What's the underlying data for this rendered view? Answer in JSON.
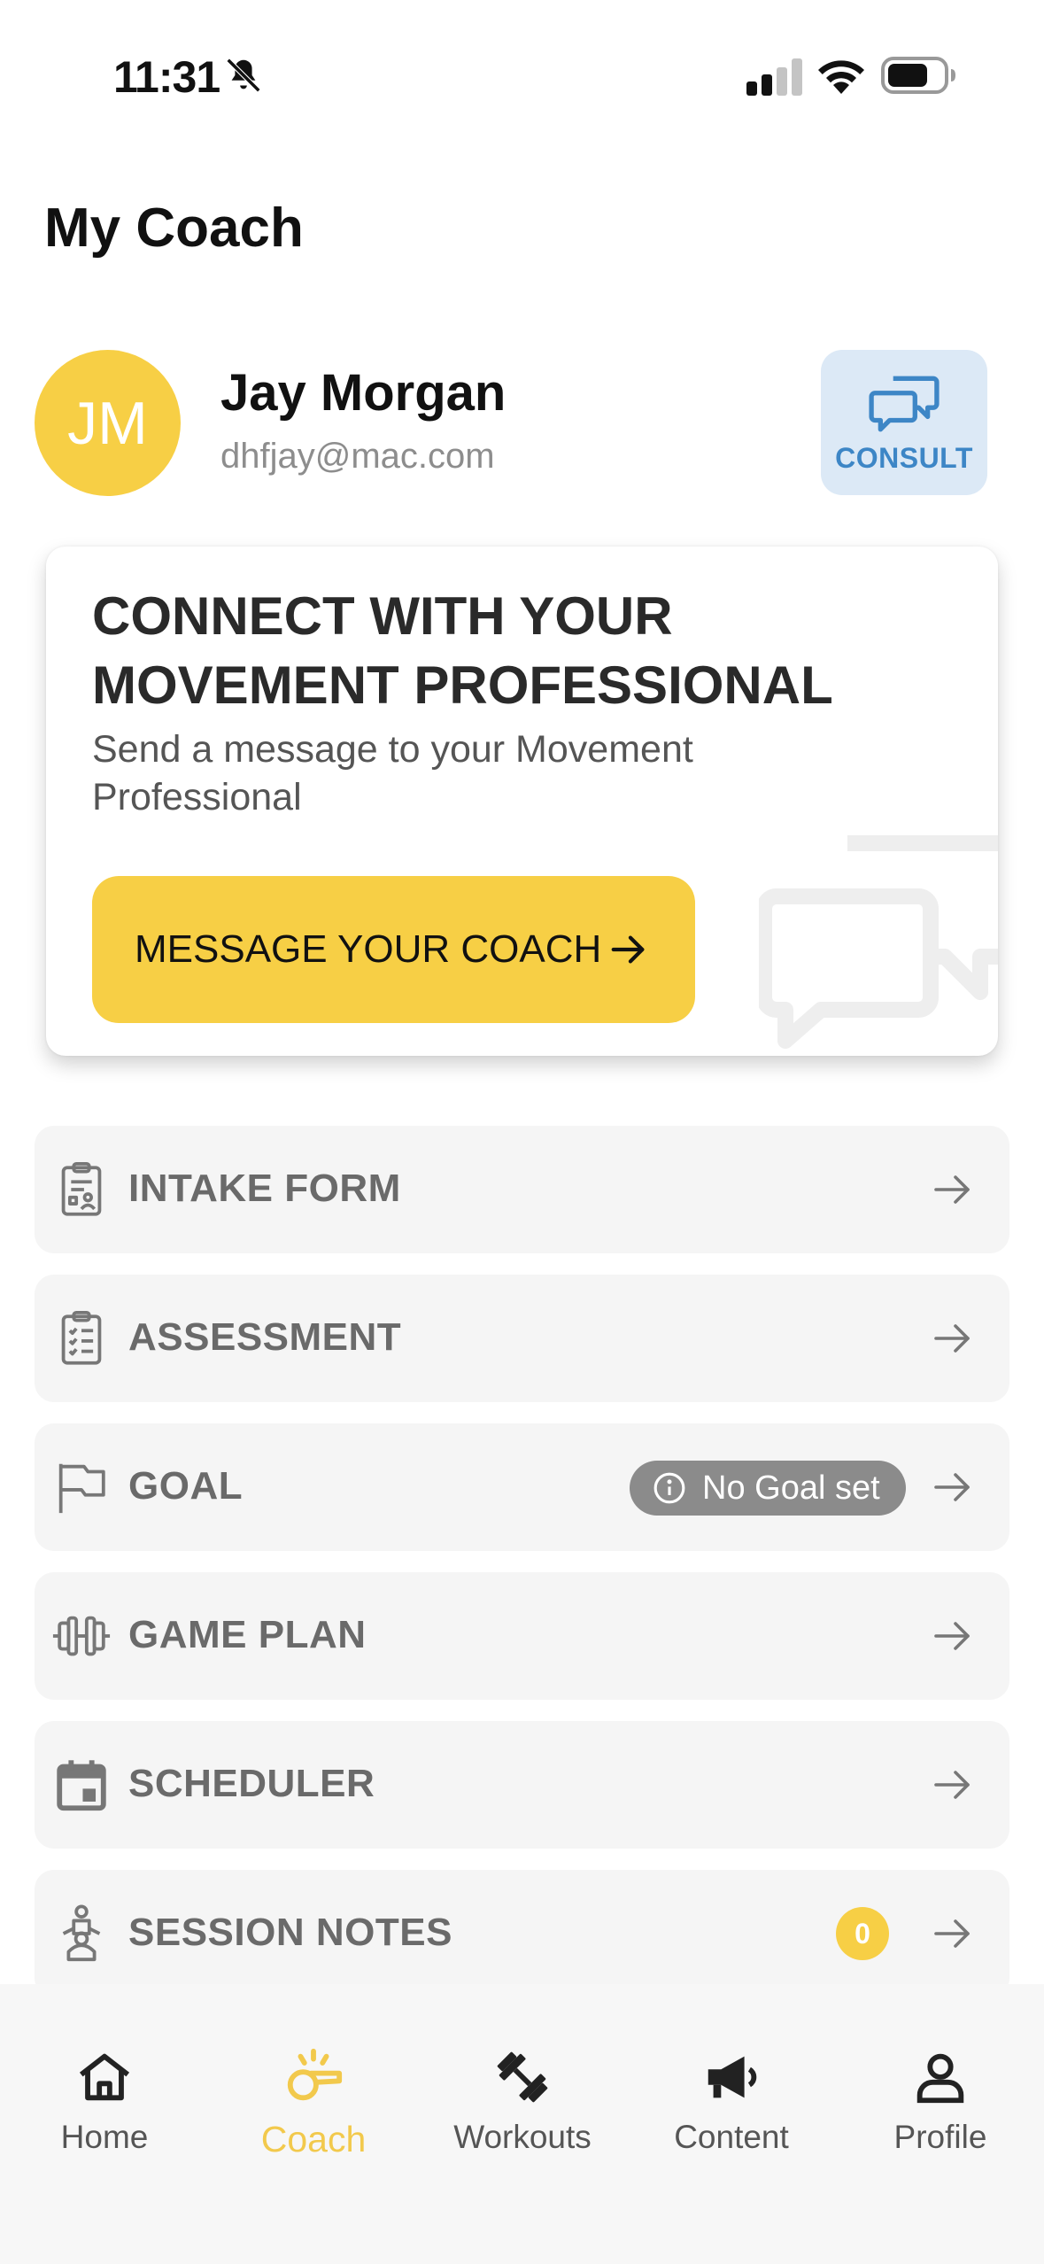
{
  "status_bar": {
    "time": "11:31"
  },
  "header": {
    "title": "My Coach"
  },
  "coach": {
    "initials": "JM",
    "name": "Jay Morgan",
    "email": "dhfjay@mac.com",
    "consult_label": "CONSULT"
  },
  "connect_card": {
    "title": "CONNECT WITH YOUR MOVEMENT PROFESSIONAL",
    "subtitle": "Send a message to your Movement Professional",
    "button_label": "MESSAGE YOUR COACH"
  },
  "menu": {
    "items": [
      {
        "label": "INTAKE FORM",
        "icon": "clipboard-person-icon"
      },
      {
        "label": "ASSESSMENT",
        "icon": "clipboard-checklist-icon"
      },
      {
        "label": "GOAL",
        "icon": "flag-icon",
        "badge": "No Goal set"
      },
      {
        "label": "GAME PLAN",
        "icon": "dumbbell-icon"
      },
      {
        "label": "SCHEDULER",
        "icon": "calendar-icon"
      },
      {
        "label": "SESSION NOTES",
        "icon": "trainer-icon",
        "count": "0"
      }
    ]
  },
  "tabs": [
    {
      "label": "Home",
      "icon": "home-icon",
      "active": false
    },
    {
      "label": "Coach",
      "icon": "whistle-icon",
      "active": true
    },
    {
      "label": "Workouts",
      "icon": "dumbbell-icon",
      "active": false
    },
    {
      "label": "Content",
      "icon": "megaphone-icon",
      "active": false
    },
    {
      "label": "Profile",
      "icon": "person-icon",
      "active": false
    }
  ],
  "colors": {
    "accent": "#f7cf45",
    "consult_bg": "#dce9f6",
    "consult_text": "#3d86c6",
    "row_bg": "#f5f5f5",
    "muted_text": "#6a6a6a"
  }
}
